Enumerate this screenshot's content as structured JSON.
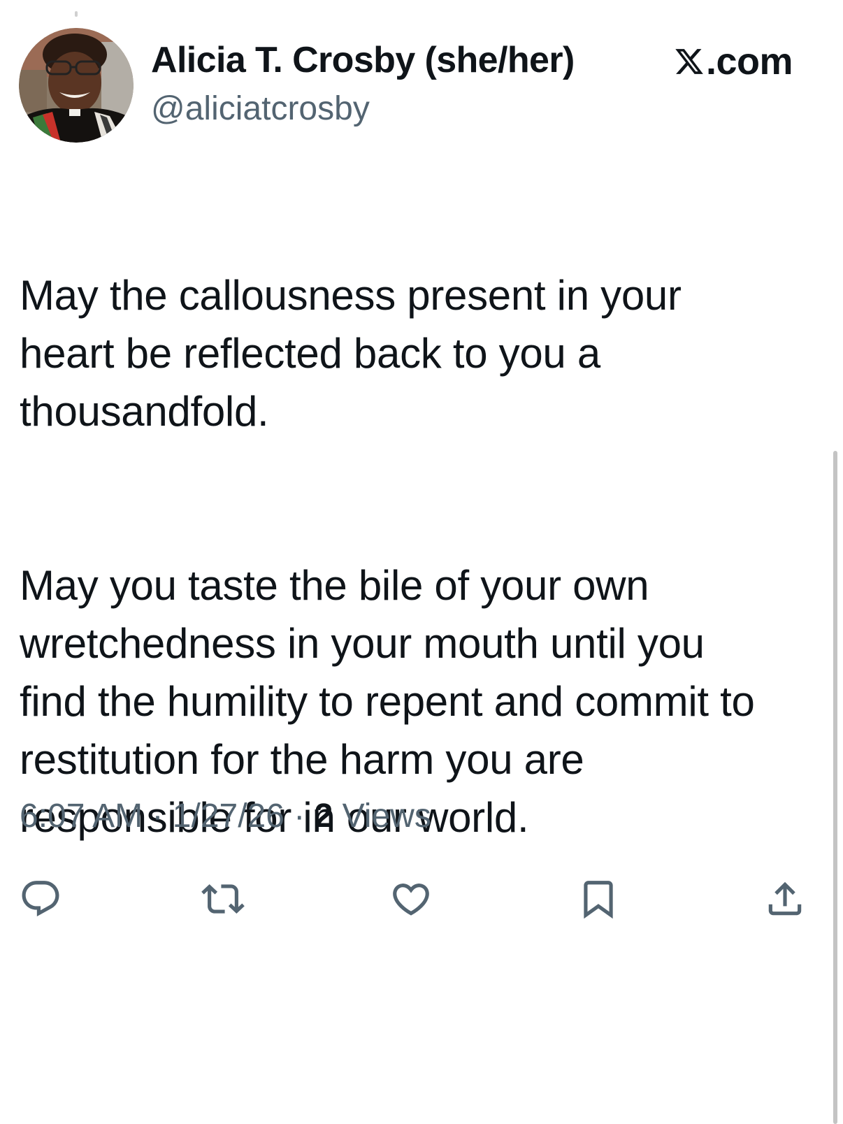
{
  "author": {
    "display_name": "Alicia T. Crosby (she/her)",
    "handle": "@aliciatcrosby"
  },
  "brand": {
    "domain": ".com",
    "icon": "x-logo-icon"
  },
  "tweet": {
    "paragraphs": [
      "May the callousness present in your\nheart be reflected back to you a\nthousandfold.",
      "May you taste the bile of your own\nwretchedness in your mouth until you\nfind the humility to repent and commit to\nrestitution for the harm you are\nresponsible for in our world."
    ]
  },
  "meta": {
    "time": "6:07 AM",
    "separator": "·",
    "date": "1/27/26",
    "views_count": "2",
    "views_label": "Views"
  },
  "actions": {
    "reply_icon": "reply-icon",
    "repost_icon": "repost-icon",
    "like_icon": "heart-icon",
    "bookmark_icon": "bookmark-icon",
    "share_icon": "share-icon"
  },
  "colors": {
    "text_primary": "#0f1419",
    "text_secondary": "#536471",
    "background": "#ffffff"
  }
}
